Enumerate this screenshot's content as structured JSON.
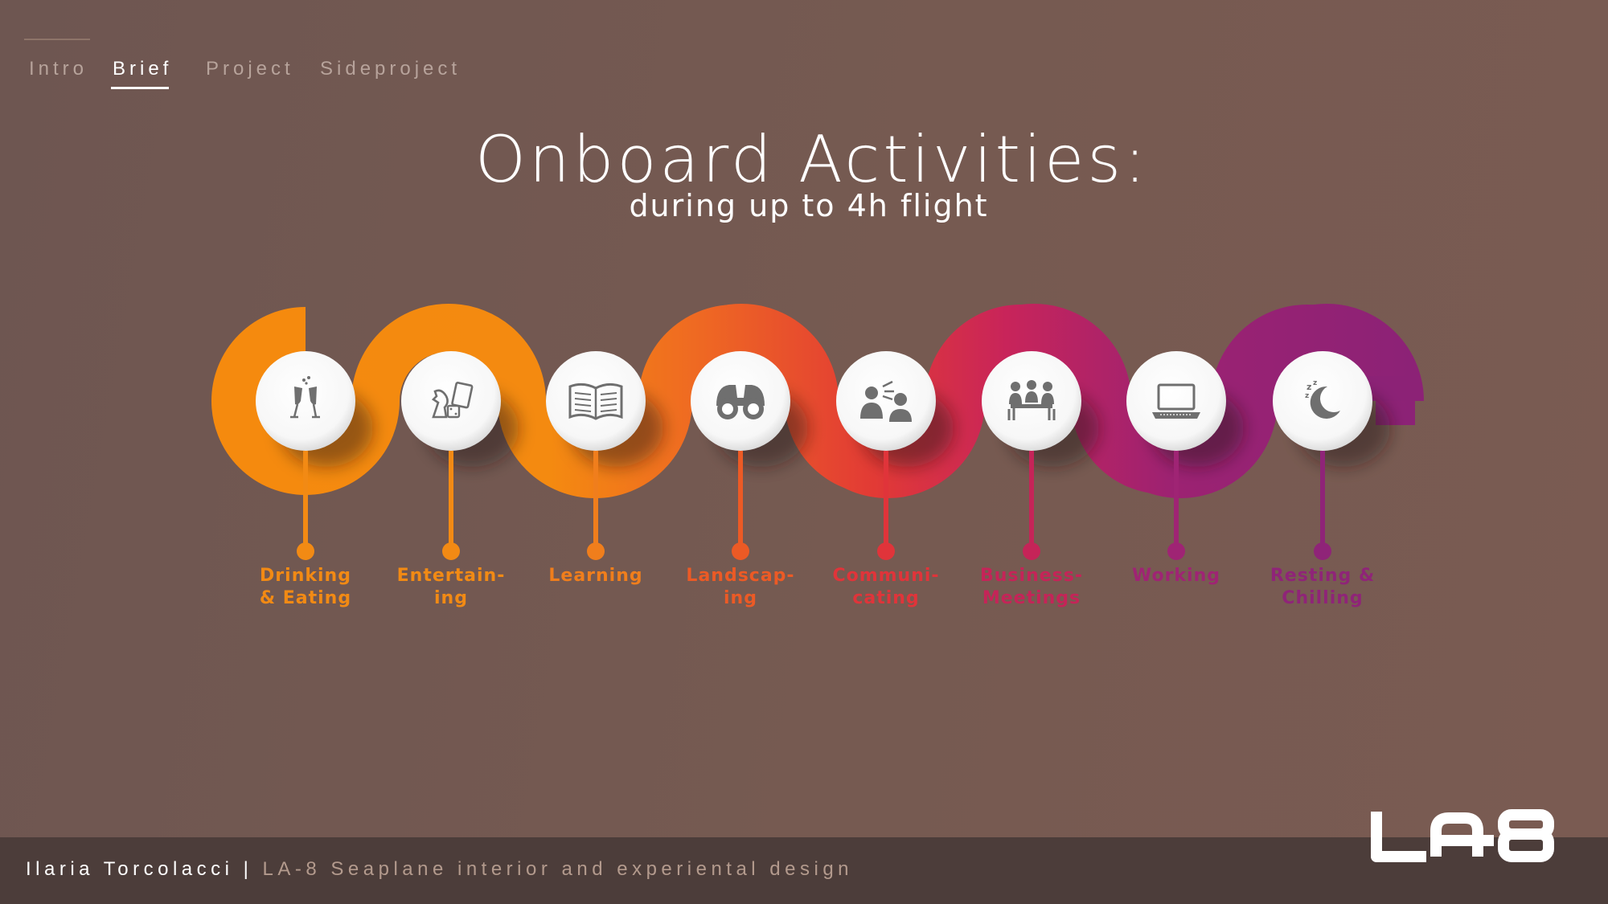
{
  "nav": {
    "items": [
      {
        "label": "Intro",
        "active": false
      },
      {
        "label": "Brief",
        "active": true
      },
      {
        "label": "Project",
        "active": false
      },
      {
        "label": "Sideproject",
        "active": false
      }
    ]
  },
  "title": "Onboard Activities:",
  "subtitle": "during up to 4h flight",
  "activities": [
    {
      "label_line1": "Drinking",
      "label_line2": "& Eating",
      "icon": "toast-glasses-icon",
      "color": "#f28a14"
    },
    {
      "label_line1": "Entertain-",
      "label_line2": "ing",
      "icon": "games-icon",
      "color": "#f28a14"
    },
    {
      "label_line1": "Learning",
      "label_line2": "",
      "icon": "open-book-icon",
      "color": "#f07e1c"
    },
    {
      "label_line1": "Landscap-",
      "label_line2": "ing",
      "icon": "binoculars-icon",
      "color": "#ec5a25"
    },
    {
      "label_line1": "Communi-",
      "label_line2": "cating",
      "icon": "people-talking-icon",
      "color": "#e0343a"
    },
    {
      "label_line1": "Business-",
      "label_line2": "Meetings",
      "icon": "meeting-table-icon",
      "color": "#c52458"
    },
    {
      "label_line1": "Working",
      "label_line2": "",
      "icon": "laptop-icon",
      "color": "#9f2474"
    },
    {
      "label_line1": "Resting &",
      "label_line2": "Chilling",
      "icon": "moon-sleep-icon",
      "color": "#8f2478"
    }
  ],
  "footer": {
    "name": "Ilaria Torcolacci",
    "separator": "|",
    "description": "LA-8 Seaplane interior and experiental design"
  },
  "logo": {
    "text": "LA-8"
  }
}
